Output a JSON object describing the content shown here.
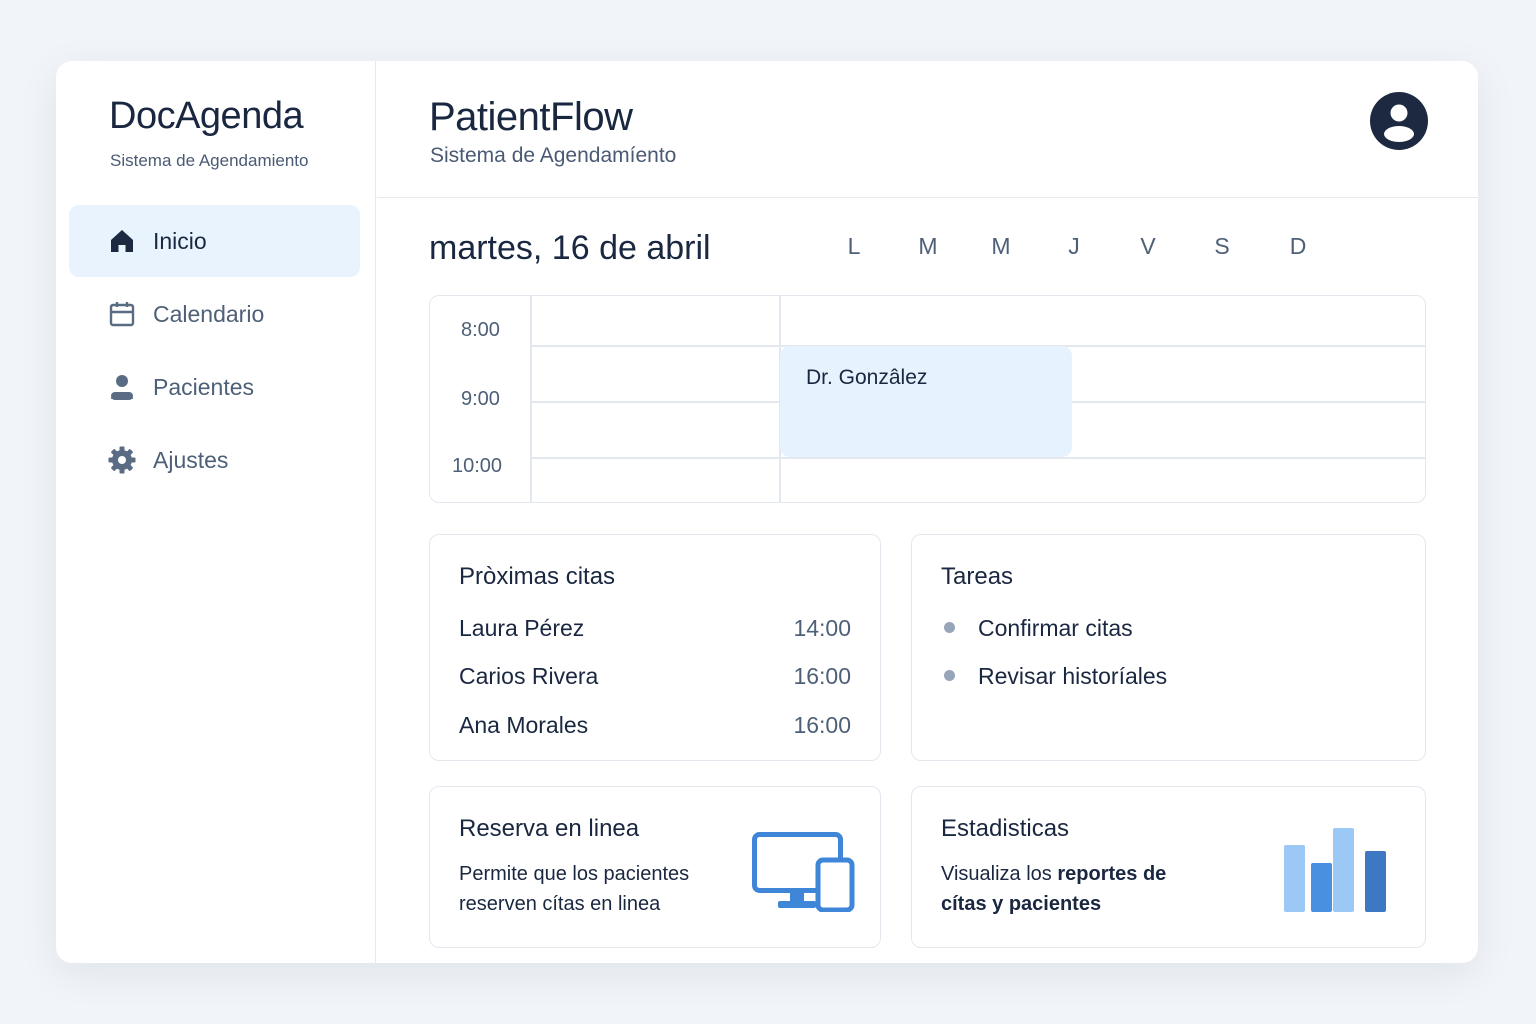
{
  "sidebar": {
    "brand": "DocAgenda",
    "brand_subtitle": "Sistema de Agendamiento",
    "items": [
      {
        "label": "Inicio",
        "icon": "home-icon",
        "active": true
      },
      {
        "label": "Calendario",
        "icon": "calendar-icon",
        "active": false
      },
      {
        "label": "Pacientes",
        "icon": "user-icon",
        "active": false
      },
      {
        "label": "Ajustes",
        "icon": "gear-icon",
        "active": false
      }
    ]
  },
  "header": {
    "title": "PatientFlow",
    "subtitle": "Sistema de Agendamíento",
    "avatar_icon": "user-avatar-icon"
  },
  "schedule": {
    "date": "martes, 16 de abril",
    "weekdays": [
      "L",
      "M",
      "M",
      "J",
      "V",
      "S",
      "D"
    ],
    "times": [
      "8:00",
      "9:00",
      "10:00"
    ],
    "event": {
      "label": "Dr. Gonzâlez"
    }
  },
  "upcoming": {
    "title": "Pròximas citas",
    "rows": [
      {
        "name": "Laura Pérez",
        "time": "14:00"
      },
      {
        "name": "Carios Rivera",
        "time": "16:00"
      },
      {
        "name": "Ana Morales",
        "time": "16:00"
      }
    ]
  },
  "tasks": {
    "title": "Tareas",
    "items": [
      "Confirmar citas",
      "Revisar historíales"
    ]
  },
  "booking": {
    "title": "Reserva en linea",
    "desc_line1": "Permite que los pacientes",
    "desc_line2": "reserven cítas en linea",
    "icon": "devices-icon"
  },
  "stats": {
    "title": "Estadisticas",
    "desc_plain": "Visualiza los ",
    "desc_bold1": "reportes de",
    "desc_bold2": "cítas y pacientes",
    "icon": "bar-chart-icon",
    "colors": [
      "#9cc8f5",
      "#4a90e0",
      "#9cc8f5",
      "#3d78c2"
    ]
  }
}
